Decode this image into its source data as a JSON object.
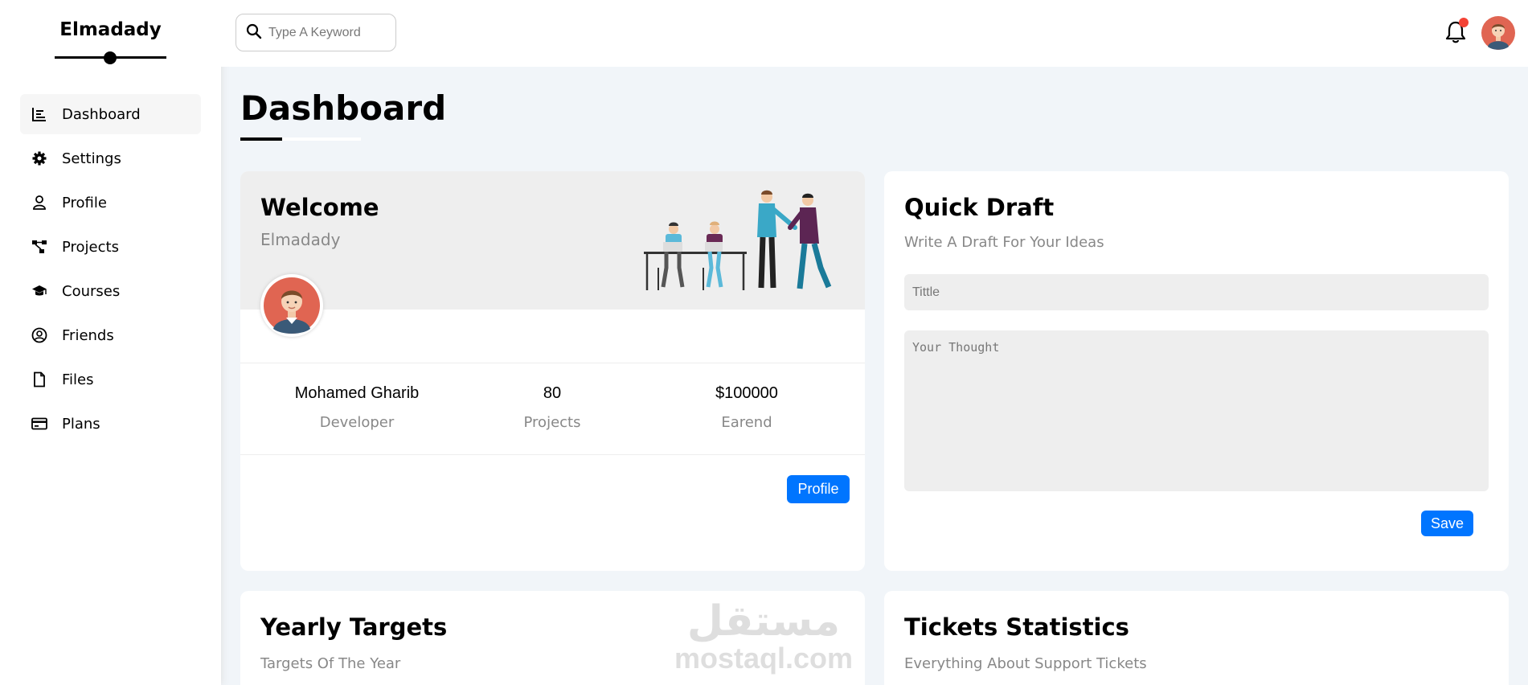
{
  "brand": {
    "name": "Elmadady"
  },
  "sidebar": {
    "items": [
      {
        "label": "Dashboard",
        "icon": "chart-icon",
        "active": true
      },
      {
        "label": "Settings",
        "icon": "gear-icon"
      },
      {
        "label": "Profile",
        "icon": "user-icon"
      },
      {
        "label": "Projects",
        "icon": "diagram-icon"
      },
      {
        "label": "Courses",
        "icon": "graduation-cap-icon"
      },
      {
        "label": "Friends",
        "icon": "user-circle-icon"
      },
      {
        "label": "Files",
        "icon": "file-icon"
      },
      {
        "label": "Plans",
        "icon": "credit-card-icon"
      }
    ]
  },
  "header": {
    "search_placeholder": "Type A Keyword",
    "has_notification": true
  },
  "page": {
    "title": "Dashboard"
  },
  "welcome": {
    "title": "Welcome",
    "name": "Elmadady",
    "stats": [
      {
        "value": "Mohamed Gharib",
        "label": "Developer"
      },
      {
        "value": "80",
        "label": "Projects"
      },
      {
        "value": "$100000",
        "label": "Earend"
      }
    ],
    "button": "Profile"
  },
  "draft": {
    "title": "Quick Draft",
    "subtitle": "Write A Draft For Your Ideas",
    "title_placeholder": "Tittle",
    "body_placeholder": "Your Thought",
    "button": "Save"
  },
  "targets": {
    "title": "Yearly Targets",
    "subtitle": "Targets Of The Year"
  },
  "tickets": {
    "title": "Tickets Statistics",
    "subtitle": "Everything About Support Tickets"
  },
  "watermark": {
    "arabic": "مستقل",
    "latin": "mostaql.com"
  },
  "colors": {
    "accent": "#0075ff",
    "background": "#f1f5f9",
    "notification": "#f44336"
  }
}
